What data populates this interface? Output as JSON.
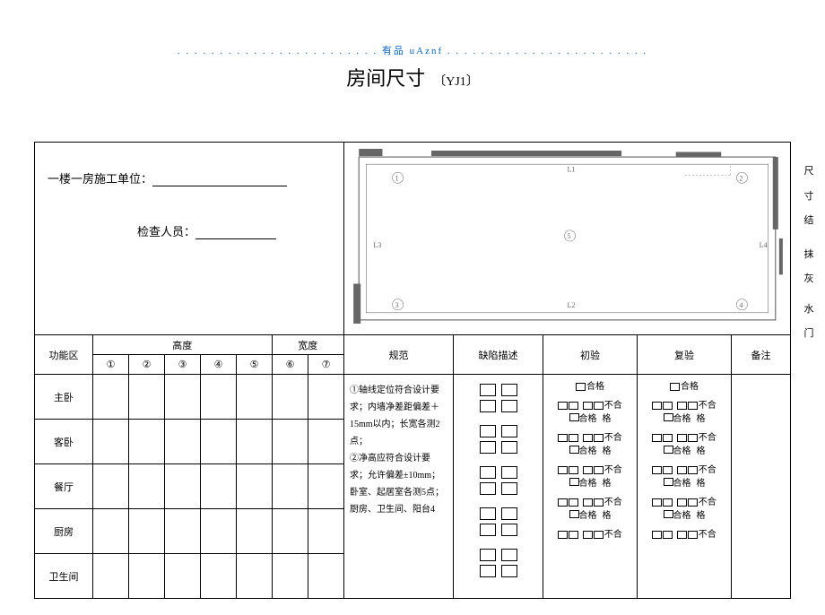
{
  "header": {
    "brand": "有品",
    "code": "uAznf"
  },
  "title": {
    "main": "房间尺寸",
    "code": "〔YJ1〕"
  },
  "info": {
    "floor_label": "一楼一房施工单位：",
    "inspector_label": "检查人员："
  },
  "side": [
    "尺",
    "寸",
    "结",
    "抹",
    "灰",
    "水",
    "门"
  ],
  "left": {
    "func": "功能区",
    "height": "高度",
    "width": "宽度",
    "nums": [
      "①",
      "②",
      "③",
      "④",
      "⑤",
      "⑥",
      "⑦"
    ],
    "rooms": [
      "主卧",
      "客卧",
      "餐厅",
      "厨房",
      "卫生间"
    ]
  },
  "right": {
    "headers": {
      "spec": "规范",
      "defect": "缺陷描述",
      "initial": "初验",
      "reinspect": "复验",
      "remark": "备注"
    },
    "spec_text": "①轴线定位符合设计要求；内墙净差距偏差＋15mm以内；长宽各测2点；\n②净高应符合设计要求；允许偏差±10mm；\n卧室、起居室各测5点；\n厨房、卫生间、阳台4",
    "pass": "合格",
    "fail": "不合格"
  }
}
